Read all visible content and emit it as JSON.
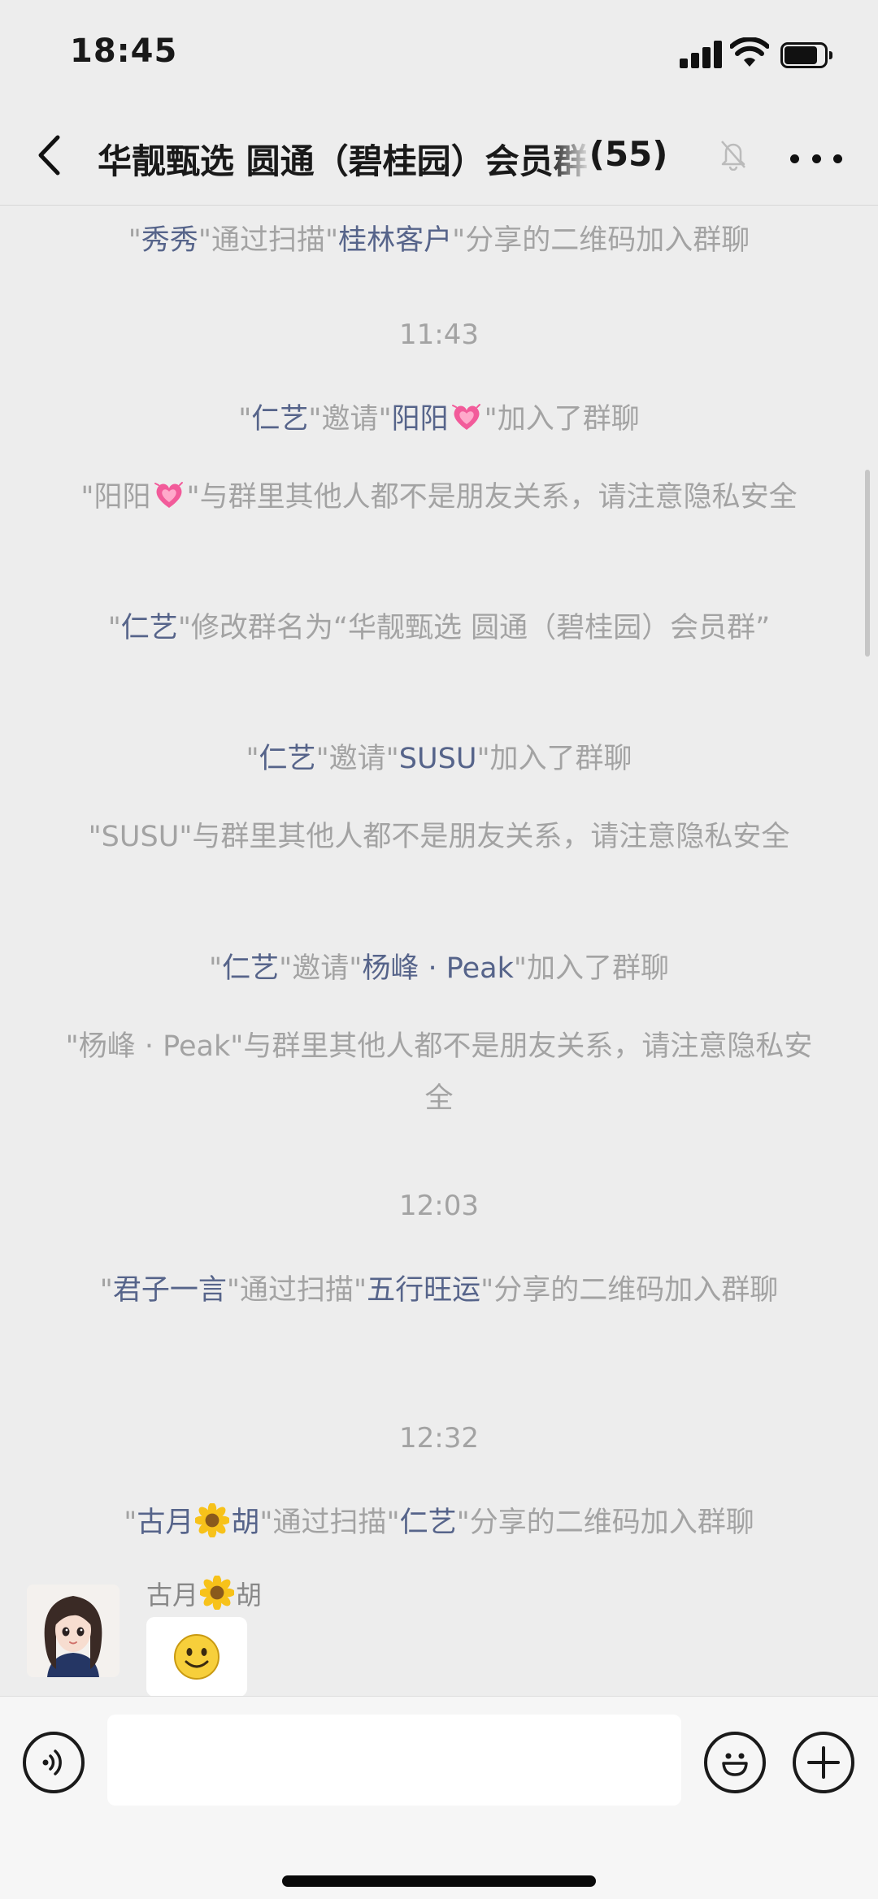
{
  "status_bar": {
    "time": "18:45"
  },
  "nav": {
    "title": "华靓甄选  圆通（碧桂园）会员群",
    "member_count": "(55)"
  },
  "messages": [
    {
      "type": "system",
      "parts": [
        {
          "t": "\""
        },
        {
          "t": "秀秀",
          "name": true
        },
        {
          "t": "\"通过扫描\""
        },
        {
          "t": "桂林客户",
          "name": true
        },
        {
          "t": "\"分享的二维码加入群聊"
        }
      ]
    },
    {
      "type": "time",
      "text": "11:43"
    },
    {
      "type": "system",
      "parts": [
        {
          "t": "\""
        },
        {
          "t": "仁艺",
          "name": true
        },
        {
          "t": "\"邀请\""
        },
        {
          "t": "阳阳",
          "name": true
        },
        {
          "icon": "heart"
        },
        {
          "t": "\"加入了群聊"
        }
      ]
    },
    {
      "type": "system",
      "parts": [
        {
          "t": "\"阳阳"
        },
        {
          "icon": "heart"
        },
        {
          "t": "\"与群里其他人都不是朋友关系，请注意隐私安全"
        }
      ]
    },
    {
      "type": "system",
      "parts": [
        {
          "t": "\""
        },
        {
          "t": "仁艺",
          "name": true
        },
        {
          "t": "\"修改群名为“华靓甄选  圆通（碧桂园）会员群”"
        }
      ]
    },
    {
      "type": "system",
      "parts": [
        {
          "t": "\""
        },
        {
          "t": "仁艺",
          "name": true
        },
        {
          "t": "\"邀请\""
        },
        {
          "t": "SUSU",
          "name": true
        },
        {
          "t": "\"加入了群聊"
        }
      ]
    },
    {
      "type": "system",
      "parts": [
        {
          "t": "\"SUSU\"与群里其他人都不是朋友关系，请注意隐私安全"
        }
      ]
    },
    {
      "type": "system",
      "parts": [
        {
          "t": "\""
        },
        {
          "t": "仁艺",
          "name": true
        },
        {
          "t": "\"邀请\""
        },
        {
          "t": "杨峰 · Peak",
          "name": true
        },
        {
          "t": "\"加入了群聊"
        }
      ]
    },
    {
      "type": "system",
      "parts": [
        {
          "t": "\"杨峰 · Peak\"与群里其他人都不是朋友关系，请注意隐私安全"
        }
      ]
    },
    {
      "type": "time",
      "text": "12:03"
    },
    {
      "type": "system",
      "parts": [
        {
          "t": "\""
        },
        {
          "t": "君子一言",
          "name": true
        },
        {
          "t": "\"通过扫描\""
        },
        {
          "t": "五行旺运",
          "name": true
        },
        {
          "t": "\"分享的二维码加入群聊"
        }
      ]
    },
    {
      "type": "time",
      "text": "12:32"
    },
    {
      "type": "system",
      "parts": [
        {
          "t": "\""
        },
        {
          "t": "古月",
          "name": true
        },
        {
          "icon": "flower"
        },
        {
          "t": "胡",
          "name": true
        },
        {
          "t": "\"通过扫描\""
        },
        {
          "t": "仁艺",
          "name": true
        },
        {
          "t": "\"分享的二维码加入群聊"
        }
      ]
    }
  ],
  "incoming": {
    "sender_prefix": "古月",
    "sender_suffix": "胡",
    "content_icon": "smiley-emoji-icon"
  },
  "icons": {
    "heart": "growing-heart-emoji",
    "flower": "sunflower-emoji"
  }
}
